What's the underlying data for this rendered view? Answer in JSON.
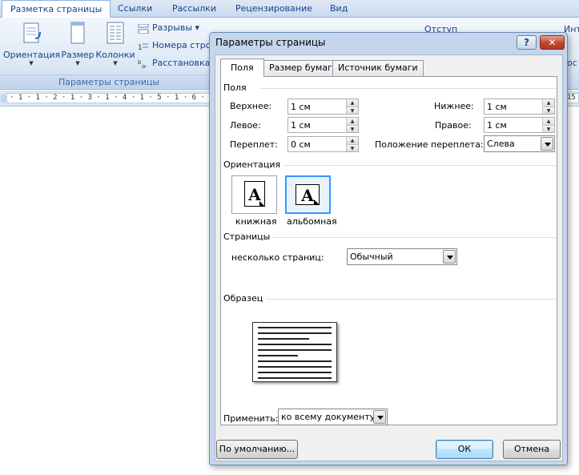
{
  "word": {
    "tabs": [
      {
        "label": "Разметка страницы",
        "active": true
      },
      {
        "label": "Ссылки"
      },
      {
        "label": "Рассылки"
      },
      {
        "label": "Рецензирование"
      },
      {
        "label": "Вид"
      }
    ],
    "ribbon": {
      "buttons": [
        "Ориентация",
        "Размер",
        "Колонки"
      ],
      "small_buttons": [
        "Разрывы ▾",
        "Номера стро",
        "Расстановка"
      ],
      "group_caption": "Параметры страницы",
      "right_labels": [
        "Отступ",
        "Интерв",
        "ос"
      ]
    },
    "ruler_text": "· 1 · 1 · 2 · 1 · 3 · 1 · 4 · 1 · 5 · 1 · 6 ·",
    "ruler_right": "15"
  },
  "dialog": {
    "title": "Параметры страницы",
    "help": "?",
    "close": "✕",
    "tabs": [
      "Поля",
      "Размер бумаги",
      "Источник бумаги"
    ],
    "margins": {
      "section": "Поля",
      "top_label": "Верхнее:",
      "top_value": "1 см",
      "bottom_label": "Нижнее:",
      "bottom_value": "1 см",
      "left_label": "Левое:",
      "left_value": "1 см",
      "right_label": "Правое:",
      "right_value": "1 см",
      "gutter_label": "Переплет:",
      "gutter_value": "0 см",
      "gutter_pos_label": "Положение переплета:",
      "gutter_pos_value": "Слева"
    },
    "orientation": {
      "section": "Ориентация",
      "portrait": "книжная",
      "landscape": "альбомная",
      "selected": "landscape"
    },
    "pages": {
      "section": "Страницы",
      "multiple_label": "несколько страниц:",
      "multiple_value": "Обычный"
    },
    "preview": {
      "section": "Образец",
      "apply_label": "Применить:",
      "apply_value": "ко всему документу"
    },
    "buttons": {
      "default": "По умолчанию...",
      "ok": "ОК",
      "cancel": "Отмена"
    }
  }
}
